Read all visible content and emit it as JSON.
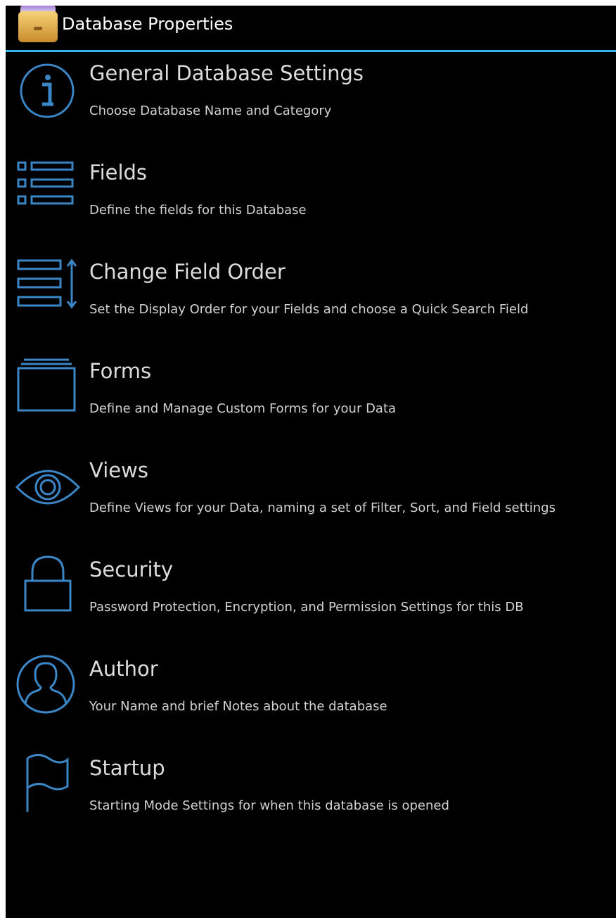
{
  "header": {
    "title": "Database Properties",
    "icon": "database-drawer-icon",
    "divider_color": "#33b5e5"
  },
  "colors": {
    "icon_blue": "#3a86c6",
    "background": "#000000",
    "title_text": "#dcdcdc",
    "desc_text": "#d2d2d2"
  },
  "menu": {
    "items": [
      {
        "title": "General Database Settings",
        "description": "Choose Database Name and Category",
        "icon": "info-icon"
      },
      {
        "title": "Fields",
        "description": "Define the fields for this Database",
        "icon": "fields-list-icon"
      },
      {
        "title": "Change Field Order",
        "description": "Set the Display Order for your Fields and choose a Quick Search Field",
        "icon": "reorder-icon"
      },
      {
        "title": "Forms",
        "description": "Define and Manage Custom Forms for your Data",
        "icon": "forms-icon"
      },
      {
        "title": "Views",
        "description": "Define Views for your Data, naming a set of Filter, Sort, and Field settings",
        "icon": "eye-icon"
      },
      {
        "title": "Security",
        "description": "Password Protection, Encryption, and Permission Settings for this DB",
        "icon": "lock-icon"
      },
      {
        "title": "Author",
        "description": "Your Name and brief Notes about the database",
        "icon": "person-icon"
      },
      {
        "title": "Startup",
        "description": "Starting Mode Settings for when this database is opened",
        "icon": "flag-icon"
      }
    ]
  }
}
